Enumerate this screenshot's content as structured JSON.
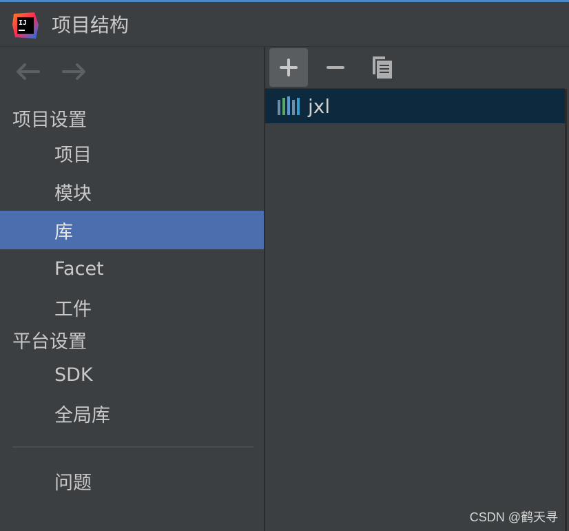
{
  "window": {
    "title": "项目结构",
    "logo_text": "IJ"
  },
  "sidebar": {
    "sections": [
      {
        "header": "项目设置",
        "items": [
          {
            "label": "项目",
            "selected": false
          },
          {
            "label": "模块",
            "selected": false
          },
          {
            "label": "库",
            "selected": true
          },
          {
            "label": "Facet",
            "selected": false
          },
          {
            "label": "工件",
            "selected": false
          }
        ]
      },
      {
        "header": "平台设置",
        "items": [
          {
            "label": "SDK",
            "selected": false
          },
          {
            "label": "全局库",
            "selected": false
          }
        ]
      }
    ],
    "problems_label": "问题"
  },
  "toolbar": {
    "buttons": [
      "plus-icon",
      "minus-icon",
      "copy-icon"
    ]
  },
  "libraries": [
    {
      "name": "jxl",
      "selected": true
    }
  ],
  "watermark": "CSDN @鹤天寻",
  "colors": {
    "selection": "#4b6eaf",
    "list_selection": "#0d293e",
    "background": "#3c3f41"
  }
}
